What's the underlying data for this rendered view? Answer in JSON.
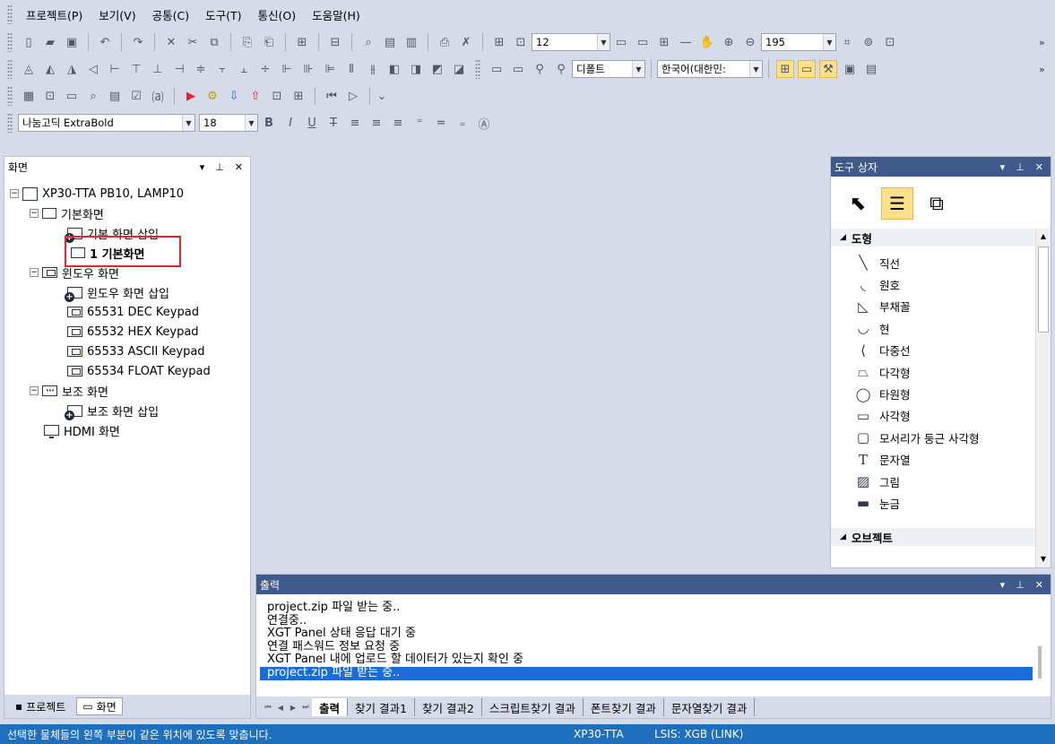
{
  "menubar": {
    "items": [
      "프로젝트(P)",
      "보기(V)",
      "공통(C)",
      "도구(T)",
      "통신(O)",
      "도움말(H)"
    ]
  },
  "toolbar2": {
    "font_size_value": "12",
    "zoom_value": "195"
  },
  "toolbar3": {
    "font_combo": "디폴트",
    "lang_combo": "한국어(대한민:"
  },
  "toolbar5": {
    "font_name": "나눔고딕 ExtraBold",
    "font_size": "18"
  },
  "left_panel": {
    "title": "화면",
    "tree": {
      "root": "XP30-TTA PB10, LAMP10",
      "basic_group": "기본화면",
      "basic_insert": "기본 화면 삽입",
      "basic_item": "1 기본화면",
      "window_group": "윈도우 화면",
      "window_insert": "윈도우 화면 삽입",
      "window_items": [
        "65531 DEC Keypad",
        "65532 HEX Keypad",
        "65533 ASCII Keypad",
        "65534 FLOAT Keypad"
      ],
      "sub_group": "보조 화면",
      "sub_insert": "보조 화면 삽입",
      "hdmi": "HDMI 화면"
    },
    "tabs": [
      "프로젝트",
      "화면"
    ]
  },
  "toolbox": {
    "title": "도구 상자",
    "section_shapes": "도형",
    "section_objects": "오브젝트",
    "items": [
      {
        "label": "직선",
        "icon": "line-icon"
      },
      {
        "label": "원호",
        "icon": "arc-icon"
      },
      {
        "label": "부채꼴",
        "icon": "sector-icon"
      },
      {
        "label": "현",
        "icon": "chord-icon"
      },
      {
        "label": "다중선",
        "icon": "polyline-icon"
      },
      {
        "label": "다각형",
        "icon": "polygon-icon"
      },
      {
        "label": "타원형",
        "icon": "ellipse-icon"
      },
      {
        "label": "사각형",
        "icon": "rectangle-icon"
      },
      {
        "label": "모서리가 둥근 사각형",
        "icon": "rounded-rectangle-icon"
      },
      {
        "label": "문자열",
        "icon": "text-icon"
      },
      {
        "label": "그림",
        "icon": "image-icon"
      },
      {
        "label": "눈금",
        "icon": "scale-icon"
      }
    ]
  },
  "output": {
    "title": "출력",
    "lines": [
      "project.zip 파일 받는 중..",
      "연결중..",
      "XGT Panel 상태 응답 대기 중",
      "연결 패스워드 정보 요청 중",
      "XGT Panel 내에 업로드 할 데이터가 있는지 확인 중",
      "project.zip 파일 받는 중.."
    ],
    "tabs": [
      "출력",
      "찾기 결과1",
      "찾기 결과2",
      "스크립트찾기 결과",
      "폰트찾기 결과",
      "문자열찾기 결과"
    ]
  },
  "statusbar": {
    "message": "선택한 물체들의 왼쪽 부분이 같은 위치에 있도록 맞춥니다.",
    "device": "XP30-TTA",
    "connection": "LSIS: XGB (LINK)"
  },
  "colors": {
    "accent": "#3d5a8a",
    "status": "#1f6fbf",
    "highlight": "#e8212b",
    "selection": "#1a6dd6"
  }
}
